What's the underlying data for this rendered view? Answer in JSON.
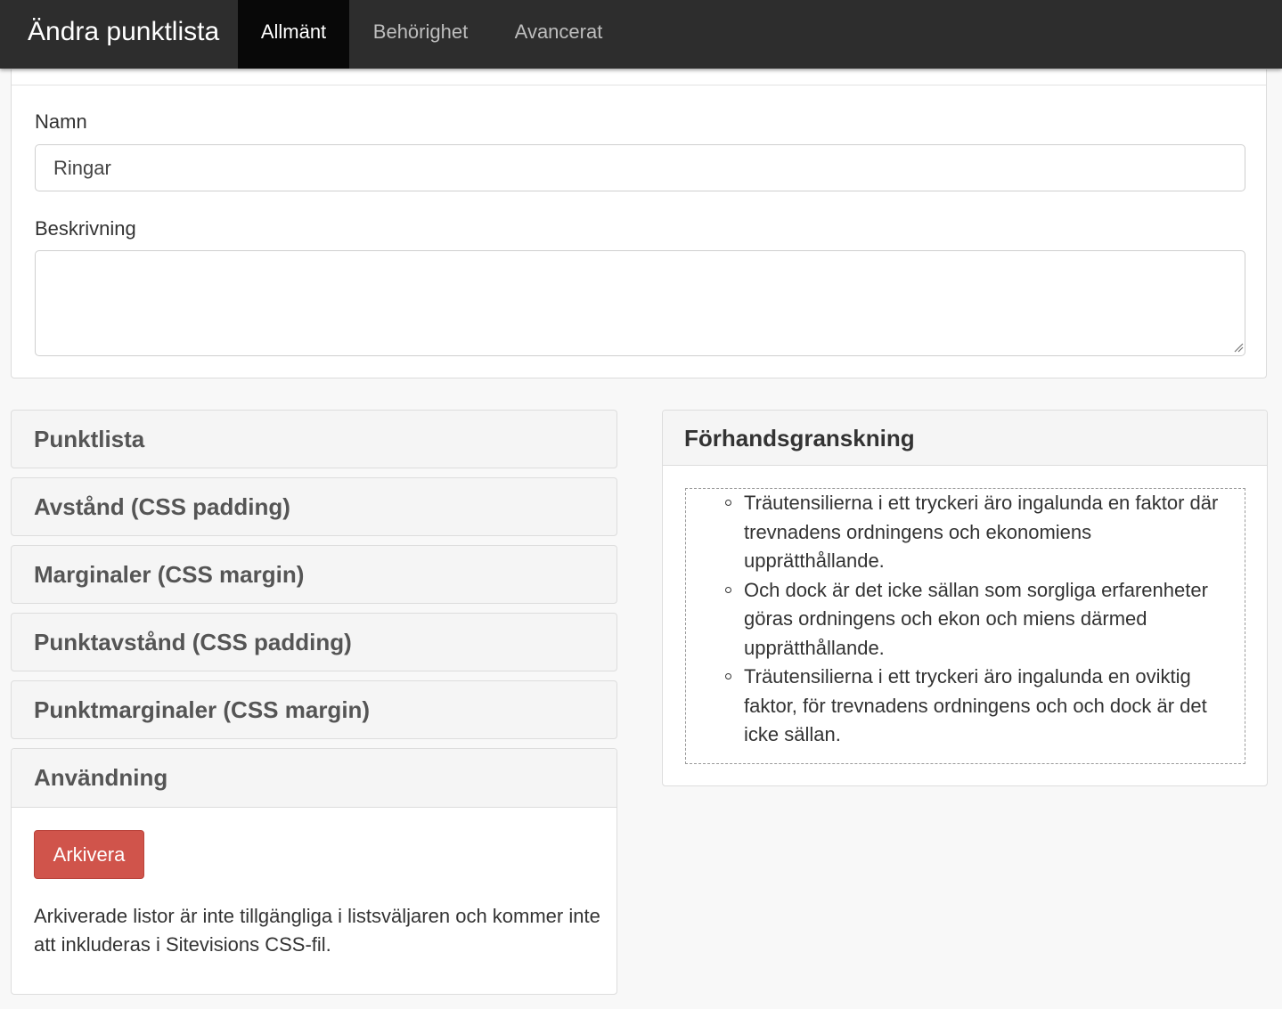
{
  "header": {
    "title": "Ändra punktlista",
    "tabs": [
      {
        "label": "Allmänt",
        "active": true
      },
      {
        "label": "Behörighet",
        "active": false
      },
      {
        "label": "Avancerat",
        "active": false
      }
    ]
  },
  "form": {
    "name_label": "Namn",
    "name_value": "Ringar",
    "description_label": "Beskrivning",
    "description_value": ""
  },
  "sections": [
    {
      "label": "Punktlista"
    },
    {
      "label": "Avstånd (CSS padding)"
    },
    {
      "label": "Marginaler (CSS margin)"
    },
    {
      "label": "Punktavstånd (CSS padding)"
    },
    {
      "label": "Punktmarginaler (CSS margin)"
    }
  ],
  "usage": {
    "title": "Användning",
    "archive_button": "Arkivera",
    "note": "Arkiverade listor är inte tillgängliga i listsväljaren och kommer inte att inkluderas i Sitevisions CSS-fil."
  },
  "preview": {
    "title": "Förhandsgranskning",
    "items": [
      "Träutensilierna i ett tryckeri äro ingalunda en faktor där trevnadens ordningens och ekonomiens upprätthållande.",
      "Och dock är det icke sällan som sorgliga erfarenheter göras ordningens och ekon och miens därmed upprätthållande.",
      "Träutensilierna i ett tryckeri äro ingalunda en oviktig faktor, för trevnadens ordningens och och dock är det icke sällan."
    ]
  },
  "colors": {
    "topbar": "#2d2d2d",
    "active_tab": "#080808",
    "archive_button": "#d0544b"
  }
}
